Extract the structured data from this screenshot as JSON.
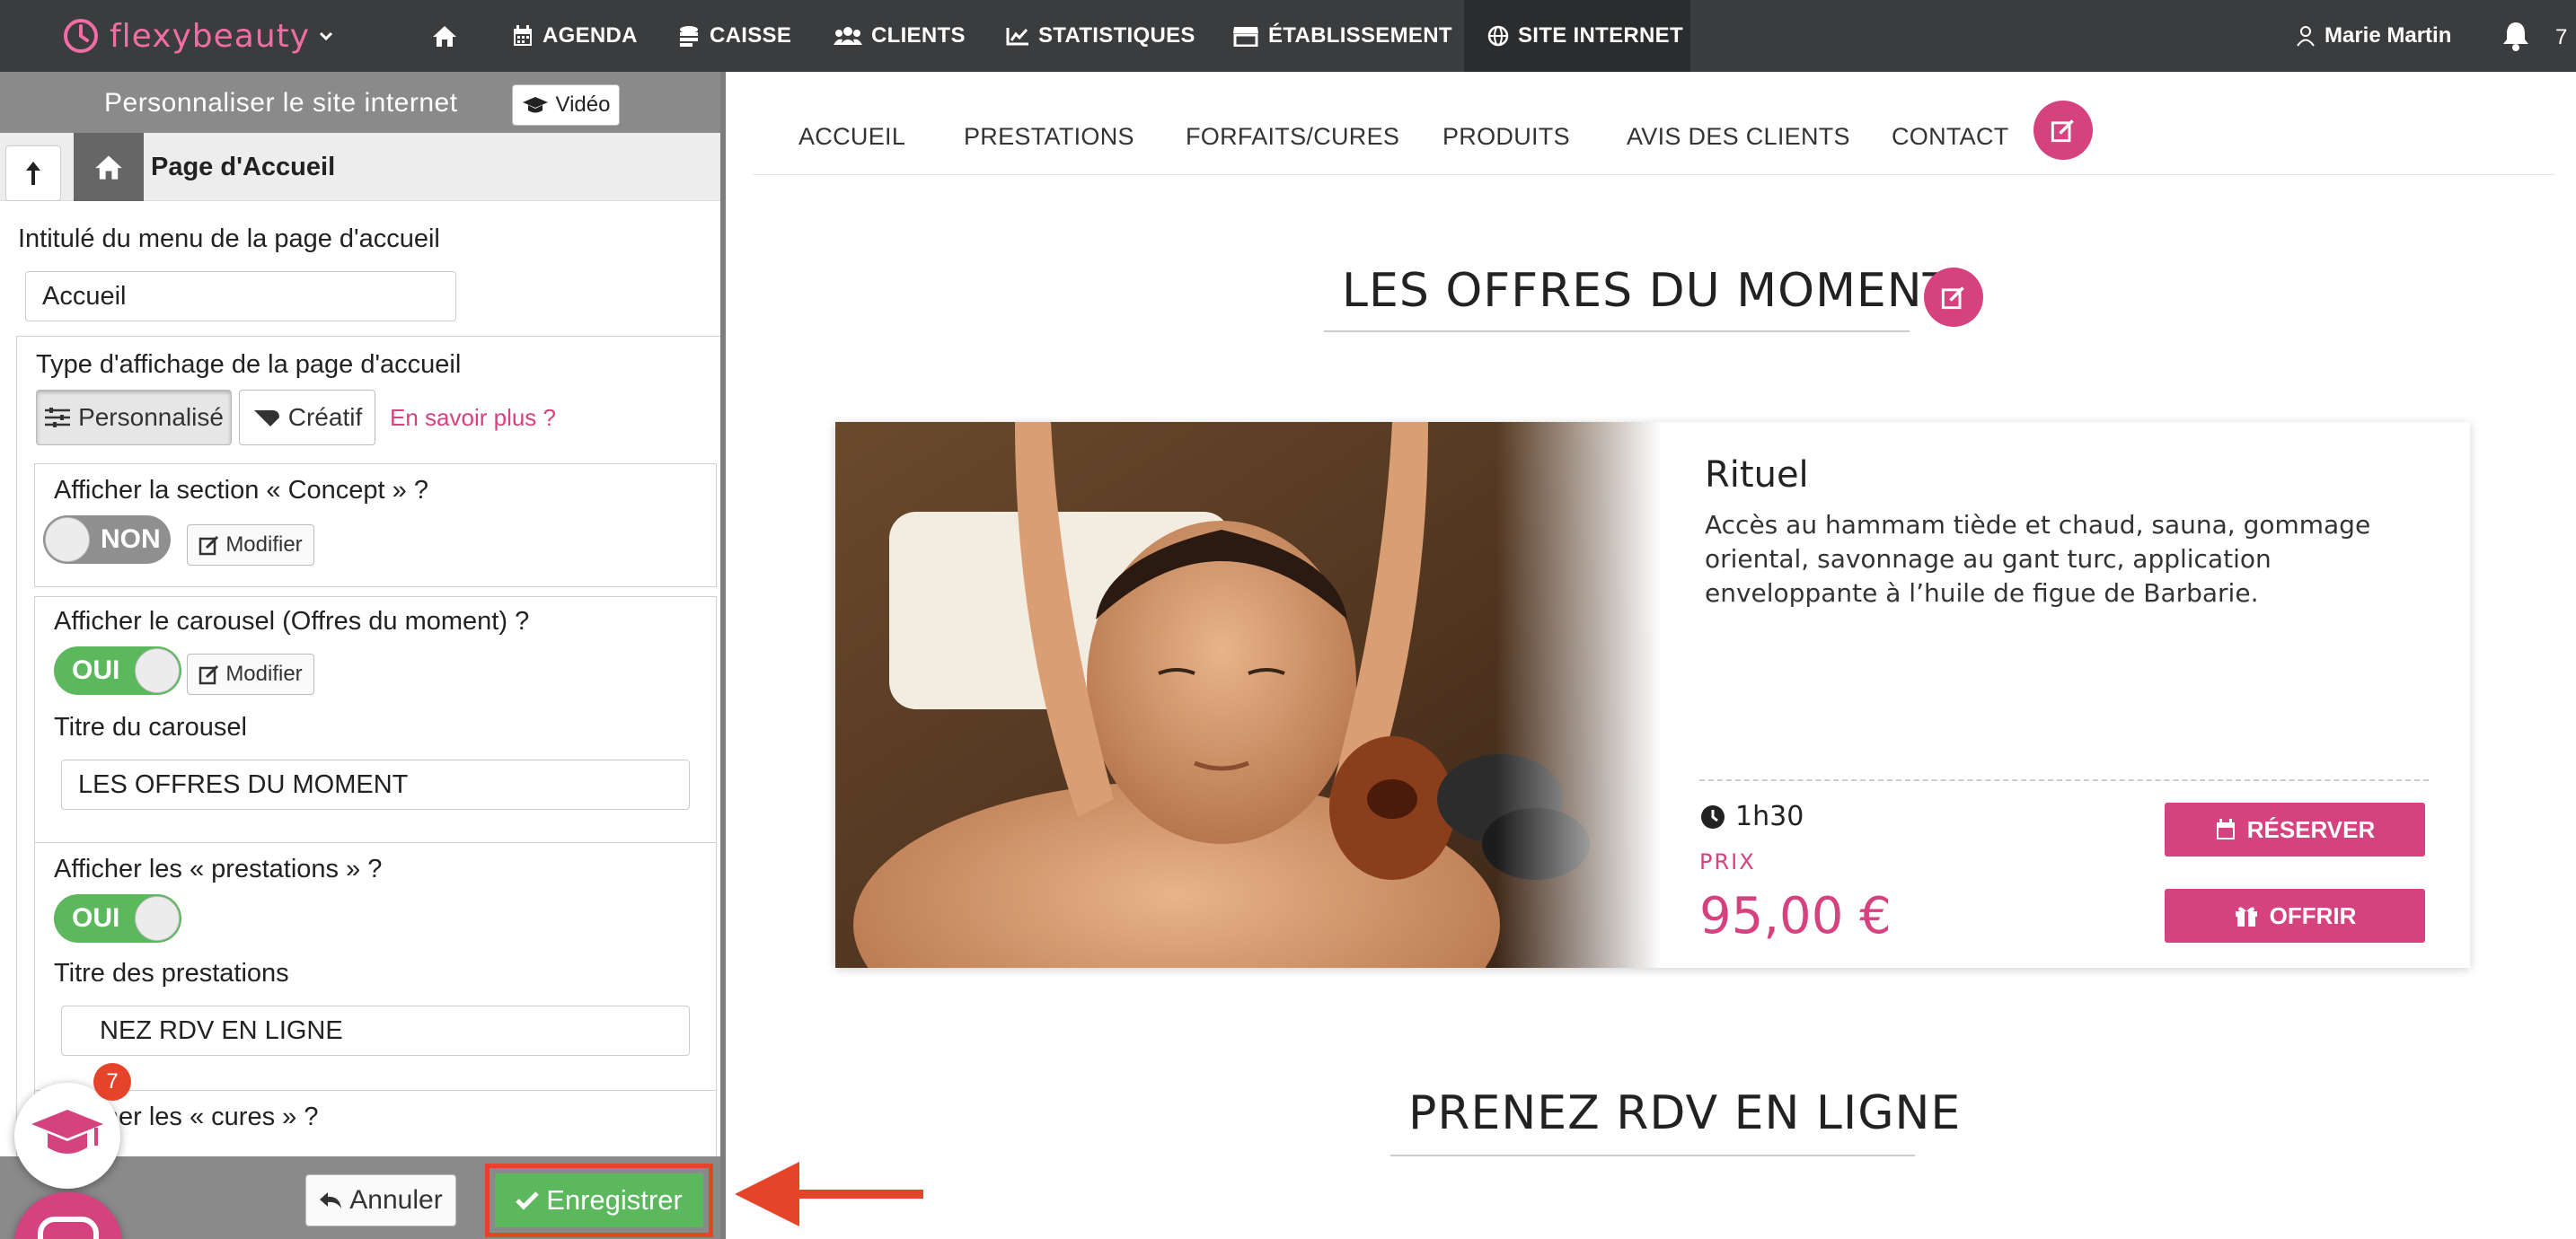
{
  "app": {
    "logo": "flexybeauty"
  },
  "topnav": {
    "items": [
      {
        "label": "AGENDA",
        "icon": "calendar-icon"
      },
      {
        "label": "CAISSE",
        "icon": "coins-icon"
      },
      {
        "label": "CLIENTS",
        "icon": "users-icon"
      },
      {
        "label": "STATISTIQUES",
        "icon": "chart-icon"
      },
      {
        "label": "ÉTABLISSEMENT",
        "icon": "store-icon"
      },
      {
        "label": "SITE INTERNET",
        "icon": "globe-icon",
        "active": true
      }
    ],
    "user": "Marie Martin",
    "notifications": "7"
  },
  "panel": {
    "title": "Personnaliser le site internet",
    "video_label": "Vidéo",
    "breadcrumb": "Page d'Accueil",
    "menu_label": "Intitulé du menu de la page d'accueil",
    "menu_value": "Accueil",
    "display_type_label": "Type d'affichage de la page d'accueil",
    "display_personnalise": "Personnalisé",
    "display_creatif": "Créatif",
    "learn_more": "En savoir plus ?",
    "concept_label": "Afficher la section « Concept » ?",
    "concept_toggle": "NON",
    "modify_label": "Modifier",
    "carousel_label": "Afficher le carousel (Offres du moment) ?",
    "carousel_toggle": "OUI",
    "carousel_title_label": "Titre du carousel",
    "carousel_title_value": "LES OFFRES DU MOMENT",
    "prestations_label": "Afficher les « prestations » ?",
    "prestations_toggle": "OUI",
    "prestations_title_label": "Titre des prestations",
    "prestations_title_value": "NEZ RDV EN LIGNE",
    "cures_label": "Afficher les « cures » ?",
    "cancel_label": "Annuler",
    "save_label": "Enregistrer",
    "help_badge": "7"
  },
  "site": {
    "nav": [
      "ACCUEIL",
      "PRESTATIONS",
      "FORFAITS/CURES",
      "PRODUITS",
      "AVIS DES CLIENTS",
      "CONTACT"
    ],
    "offers_title": "LES OFFRES DU MOMENT",
    "card": {
      "title": "Rituel",
      "description": "Accès au hammam tiède et chaud, sauna, gommage oriental, savonnage au gant turc, application enveloppante à l’huile de figue de Barbarie.",
      "duration": "1h30",
      "price_label": "PRIX",
      "price": "95,00 €",
      "reserve_label": "RÉSERVER",
      "offer_label": "OFFRIR"
    },
    "rdv_title": "PRENEZ RDV EN LIGNE"
  },
  "colors": {
    "brand": "#d6417f",
    "success": "#5cb85c",
    "topbar": "#3b3c3e",
    "highlight": "#e5432a"
  }
}
